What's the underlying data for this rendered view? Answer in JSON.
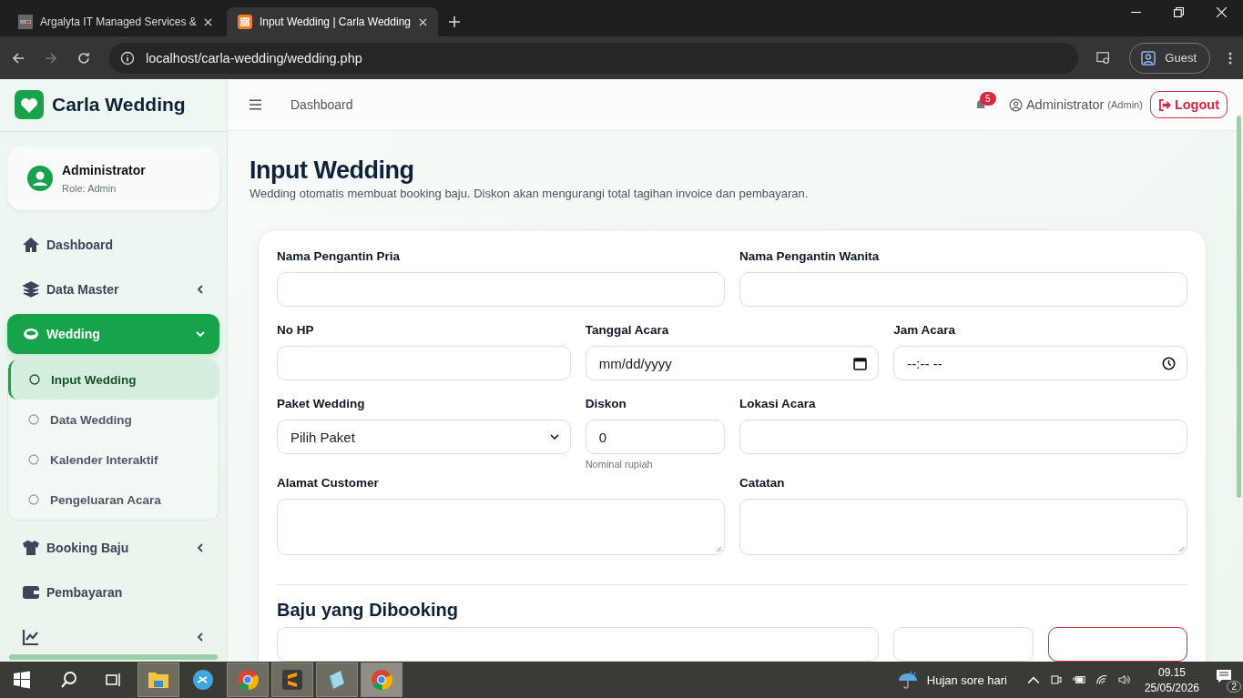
{
  "browser": {
    "tabs": [
      {
        "title": "Argalyta IT Managed Services &",
        "selected": false
      },
      {
        "title": "Input Wedding | Carla Wedding",
        "selected": true
      }
    ],
    "url": "localhost/carla-wedding/wedding.php",
    "profile": "Guest"
  },
  "sidebar": {
    "brand": "Carla Wedding",
    "user": {
      "name": "Administrator",
      "role": "Role: Admin"
    },
    "items": [
      {
        "label": "Dashboard",
        "selected": false
      },
      {
        "label": "Data Master",
        "selected": false,
        "expanded": false
      },
      {
        "label": "Wedding",
        "selected": true,
        "expanded": true,
        "children": [
          {
            "label": "Input Wedding",
            "selected": true
          },
          {
            "label": "Data Wedding",
            "selected": false
          },
          {
            "label": "Kalender Interaktif",
            "selected": false
          },
          {
            "label": "Pengeluaran Acara",
            "selected": false
          }
        ]
      },
      {
        "label": "Booking Baju",
        "selected": false,
        "expanded": false
      },
      {
        "label": "Pembayaran",
        "selected": false
      },
      {
        "selected": false,
        "expanded": false
      }
    ]
  },
  "topbar": {
    "breadcrumb": "Dashboard",
    "notifications": "5",
    "user": "Administrator",
    "role": "(Admin)",
    "logout": "Logout"
  },
  "page": {
    "title": "Input Wedding",
    "subtitle": "Wedding otomatis membuat booking baju. Diskon akan mengurangi total tagihan invoice dan pembayaran.",
    "form": [
      [
        {
          "label": "Nama Pengantin Pria",
          "kind": "text"
        },
        {
          "label": "Nama Pengantin Wanita",
          "kind": "text"
        }
      ],
      [
        {
          "label": "No HP",
          "kind": "text"
        },
        {
          "label": "Tanggal Acara",
          "kind": "date",
          "value": "mm/dd/yyyy"
        },
        {
          "label": "Jam Acara",
          "kind": "time",
          "value": "--:-- --"
        }
      ],
      [
        {
          "label": "Paket Wedding",
          "kind": "select",
          "value": "Pilih Paket"
        },
        {
          "label": "Diskon",
          "kind": "text",
          "value": "0",
          "hint": "Nominal rupiah"
        },
        {
          "label": "Lokasi Acara",
          "kind": "text"
        }
      ],
      [
        {
          "label": "Alamat Customer",
          "kind": "textarea"
        },
        {
          "label": "Catatan",
          "kind": "textarea"
        }
      ]
    ],
    "section": "Baju yang Dibooking",
    "booking_row": [
      {
        "kind": "field"
      },
      {
        "kind": "field"
      },
      {
        "kind": "danger-button"
      }
    ]
  },
  "taskbar": {
    "apps": [
      {
        "running": true,
        "selected": false
      },
      {
        "running": false,
        "selected": false
      },
      {
        "running": true,
        "selected": false
      },
      {
        "running": true,
        "selected": false
      },
      {
        "running": true,
        "selected": false
      },
      {
        "running": true,
        "selected": true
      }
    ],
    "weather": "Hujan sore hari",
    "time": "09.15",
    "date": "25/05/2026",
    "notifications": "2"
  }
}
